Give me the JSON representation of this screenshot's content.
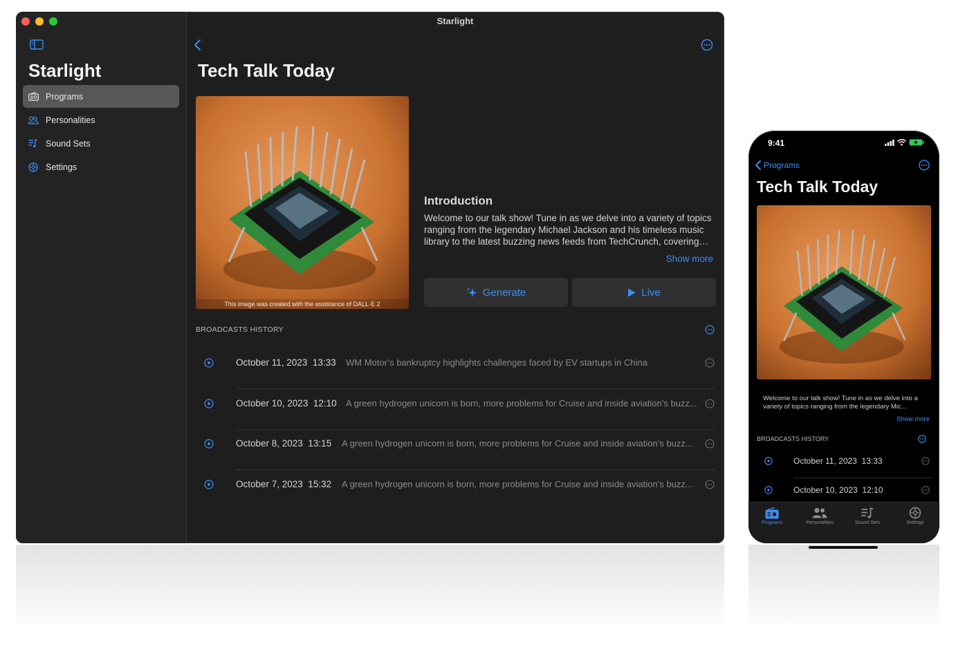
{
  "mac": {
    "window_title": "Starlight",
    "sidebar": {
      "app_title": "Starlight",
      "items": [
        {
          "label": "Programs",
          "icon": "radio-icon",
          "active": true
        },
        {
          "label": "Personalities",
          "icon": "people-icon",
          "active": false
        },
        {
          "label": "Sound Sets",
          "icon": "music-list-icon",
          "active": false
        },
        {
          "label": "Settings",
          "icon": "gear-icon",
          "active": false
        }
      ]
    },
    "detail": {
      "title": "Tech Talk Today",
      "artwork_caption": "This image was created with the assistance of DALL·E 2",
      "intro_heading": "Introduction",
      "intro_text": "Welcome to our talk show! Tune in as we delve into a variety of topics ranging from the legendary Michael Jackson and his timeless music library to the latest buzzing news feeds from TechCrunch, covering ev...",
      "show_more": "Show more",
      "generate_label": "Generate",
      "live_label": "Live",
      "broadcasts_label": "BROADCASTS HISTORY",
      "broadcasts": [
        {
          "date": "October 11, 2023",
          "time": "13:33",
          "desc": "WM Motor’s bankruptcy highlights challenges faced by EV startups in China"
        },
        {
          "date": "October 10, 2023",
          "time": "12:10",
          "desc": "A green hydrogen unicorn is born, more problems for Cruise and inside aviation’s buzz..."
        },
        {
          "date": "October 8, 2023",
          "time": "13:15",
          "desc": "A green hydrogen unicorn is born, more problems for Cruise and inside aviation’s buzz..."
        },
        {
          "date": "October 7, 2023",
          "time": "15:32",
          "desc": "A green hydrogen unicorn is born, more problems for Cruise and inside aviation’s buzz..."
        }
      ]
    }
  },
  "phone": {
    "time": "9:41",
    "back_label": "Programs",
    "title": "Tech Talk Today",
    "intro_text": "Welcome to our talk show! Tune in as we delve into a variety of topics ranging from the legendary Mic...",
    "show_more": "Show more",
    "broadcasts_label": "BROADCASTS HISTORY",
    "broadcasts": [
      {
        "date": "October 11, 2023",
        "time": "13:33"
      },
      {
        "date": "October 10, 2023",
        "time": "12:10"
      }
    ],
    "tabs": [
      {
        "label": "Programs",
        "icon": "radio-icon",
        "active": true
      },
      {
        "label": "Personalities",
        "icon": "people-icon",
        "active": false
      },
      {
        "label": "Sound Sets",
        "icon": "music-list-icon",
        "active": false
      },
      {
        "label": "Settings",
        "icon": "gear-icon",
        "active": false
      }
    ]
  },
  "colors": {
    "accent": "#3b8ff7",
    "window_bg": "#1e1e1e",
    "sidebar_bg": "#232323",
    "button_bg": "#303030"
  }
}
